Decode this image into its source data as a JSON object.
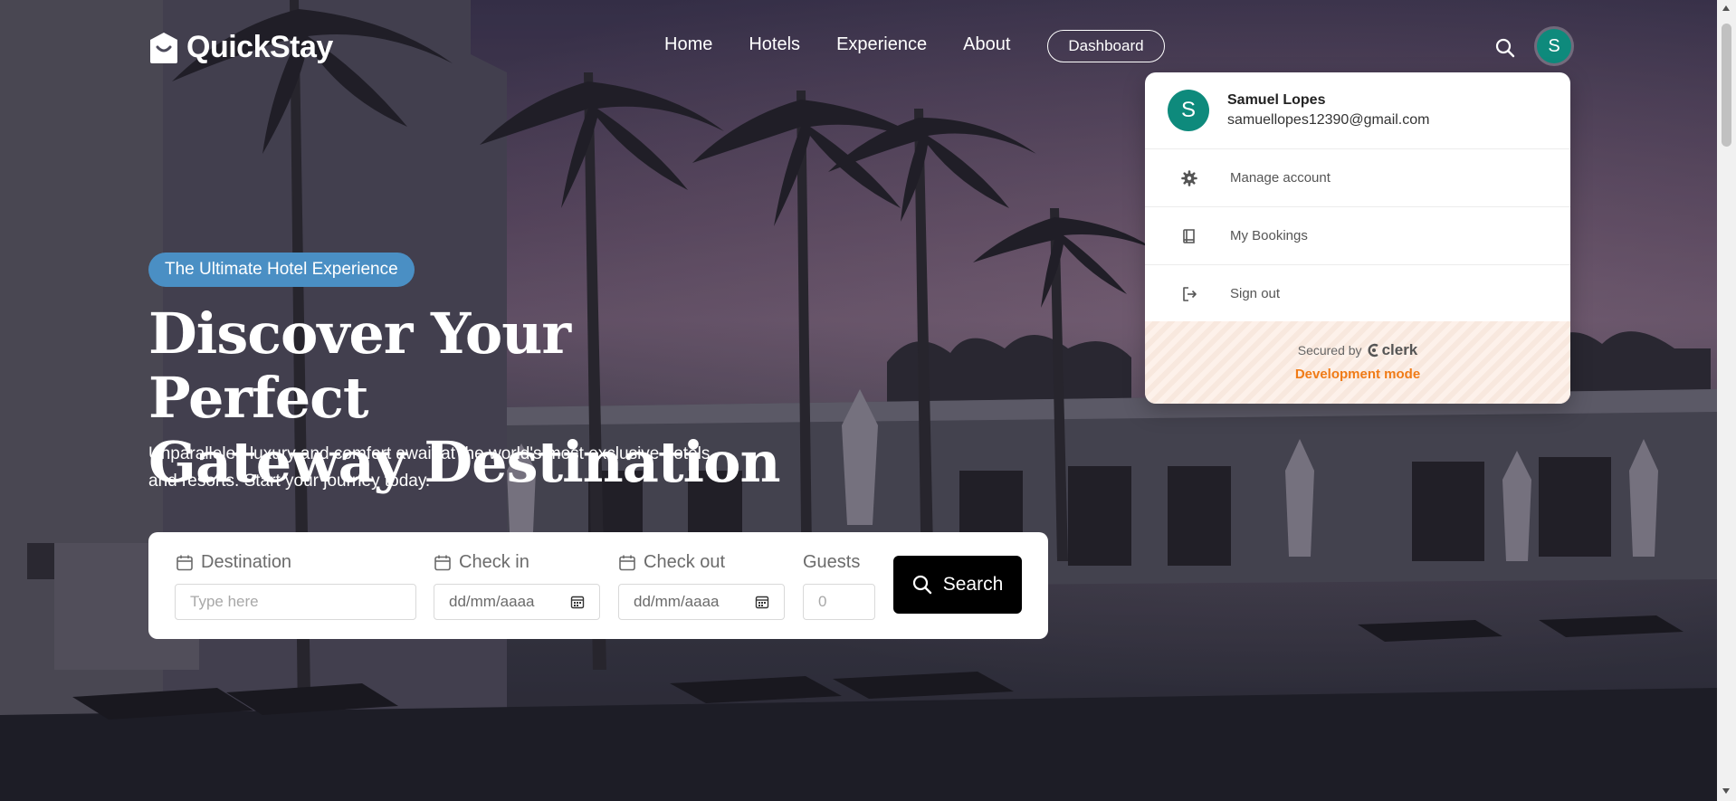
{
  "brand": {
    "name": "QuickStay"
  },
  "nav": {
    "links": [
      "Home",
      "Hotels",
      "Experience",
      "About"
    ],
    "dashboard_label": "Dashboard",
    "avatar_initial": "S"
  },
  "hero": {
    "badge": "The Ultimate Hotel Experience",
    "headline_line1": "Discover Your Perfect",
    "headline_line2": "Gateway Destination",
    "subtext": "Unparalleled luxury and comfort await at the world's most exclusive hotels and resorts. Start your journey today."
  },
  "search_form": {
    "destination_label": "Destination",
    "destination_placeholder": "Type here",
    "checkin_label": "Check in",
    "checkin_value": "dd/mm/aaaa",
    "checkout_label": "Check out",
    "checkout_value": "dd/mm/aaaa",
    "guests_label": "Guests",
    "guests_placeholder": "0",
    "search_label": "Search"
  },
  "user_menu": {
    "avatar_initial": "S",
    "name": "Samuel Lopes",
    "email": "samuellopes12390@gmail.com",
    "items": [
      {
        "label": "Manage account",
        "icon": "gear-icon"
      },
      {
        "label": "My Bookings",
        "icon": "book-icon"
      },
      {
        "label": "Sign out",
        "icon": "sign-out-icon"
      }
    ],
    "secured_by": "Secured by",
    "provider": "clerk",
    "dev_mode": "Development mode"
  },
  "colors": {
    "badge_bg": "#4a8fc4",
    "avatar_bg": "#0e8a7c",
    "dev_mode": "#f07b17",
    "search_button": "#000000"
  }
}
